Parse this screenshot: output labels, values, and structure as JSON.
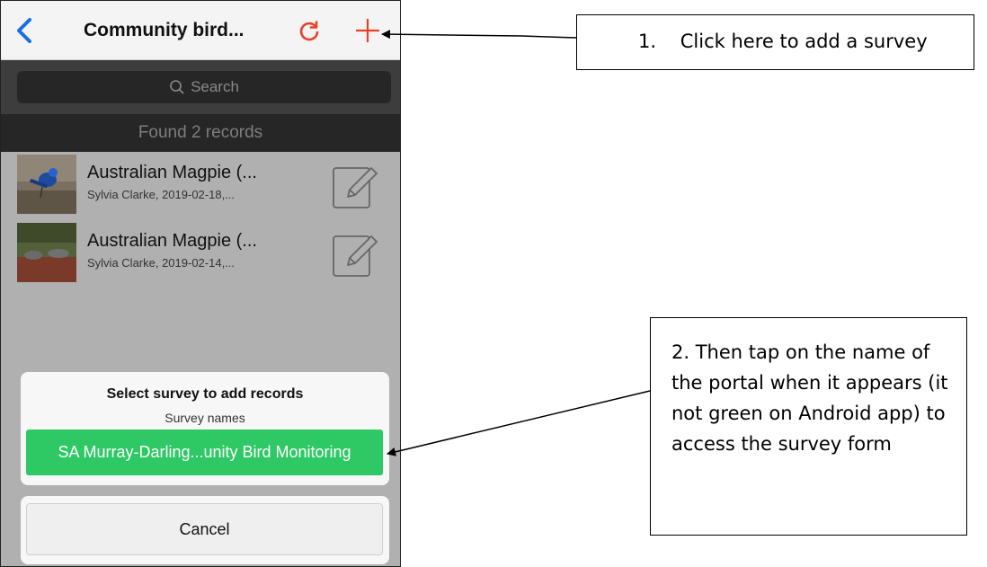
{
  "nav": {
    "title": "Community bird...",
    "back_icon": "chevron-left-icon",
    "refresh_icon": "refresh-icon",
    "add_icon": "plus-icon"
  },
  "search": {
    "placeholder": "Search"
  },
  "found_text": "Found 2 records",
  "records": [
    {
      "title": "Australian Magpie (...",
      "subtitle": "Sylvia Clarke, 2019-02-18,..."
    },
    {
      "title": "Australian Magpie (...",
      "subtitle": "Sylvia Clarke, 2019-02-14,..."
    }
  ],
  "sheet": {
    "title": "Select survey to add records",
    "subtitle": "Survey names",
    "survey_button": "SA Murray-Darling...unity Bird Monitoring",
    "cancel_button": "Cancel"
  },
  "callouts": {
    "step1_number": "1.",
    "step1_text": "Click here to add a survey",
    "step2_text": "2. Then tap on the name of the portal when it appears (it not green on Android app) to access the survey form"
  },
  "colors": {
    "accent_red": "#e8412b",
    "back_blue": "#1a6ee8",
    "survey_green": "#2ec865"
  }
}
